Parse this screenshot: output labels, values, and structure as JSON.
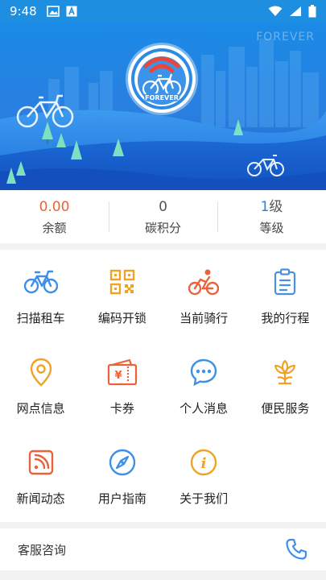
{
  "status_bar": {
    "time": "9:48"
  },
  "hero": {
    "watermark": "FOREVER",
    "logo_text": "FOREVER"
  },
  "stats": [
    {
      "value": "0.00",
      "label": "余额"
    },
    {
      "value": "0",
      "label": "碳积分"
    },
    {
      "value_prefix": "1",
      "value_suffix": "级",
      "label": "等级"
    }
  ],
  "grid": [
    {
      "label": "扫描租车",
      "icon": "bicycle-icon",
      "color": "#3d8fe8"
    },
    {
      "label": "编码开锁",
      "icon": "qr-code-icon",
      "color": "#f0a226"
    },
    {
      "label": "当前骑行",
      "icon": "cyclist-icon",
      "color": "#e8623a"
    },
    {
      "label": "我的行程",
      "icon": "clipboard-icon",
      "color": "#4a8fe0"
    },
    {
      "label": "网点信息",
      "icon": "location-pin-icon",
      "color": "#f0a226"
    },
    {
      "label": "卡券",
      "icon": "coupon-icon",
      "color": "#e8623a"
    },
    {
      "label": "个人消息",
      "icon": "chat-bubble-icon",
      "color": "#3d8fe8"
    },
    {
      "label": "便民服务",
      "icon": "flower-icon",
      "color": "#f0a226"
    },
    {
      "label": "新闻动态",
      "icon": "rss-icon",
      "color": "#e8623a"
    },
    {
      "label": "用户指南",
      "icon": "compass-icon",
      "color": "#3d8fe8"
    },
    {
      "label": "关于我们",
      "icon": "info-icon",
      "color": "#f0a226"
    }
  ],
  "service": {
    "label": "客服咨询",
    "icon": "phone-icon"
  },
  "colors": {
    "primary": "#2a7fe0",
    "accent_red": "#e8623a",
    "accent_orange": "#f0a226"
  }
}
